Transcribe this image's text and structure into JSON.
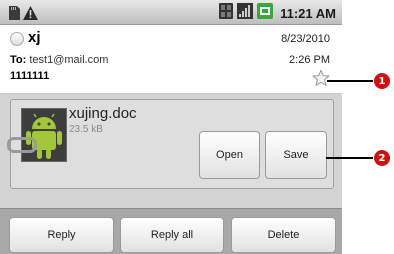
{
  "status_bar": {
    "time": "11:21 AM",
    "left_icons": [
      "sd-card-icon",
      "warning-icon"
    ],
    "right_icons": [
      "3g-icon",
      "signal-icon",
      "battery-icon"
    ]
  },
  "message": {
    "sender": "xj",
    "date": "8/23/2010",
    "time": "2:26 PM",
    "to_label": "To:",
    "to_value": "test1@mail.com",
    "subject": "1111111",
    "starred": false
  },
  "attachment": {
    "filename": "xujing.doc",
    "size": "23.5 kB",
    "open_label": "Open",
    "save_label": "Save"
  },
  "bottom_bar": {
    "reply_label": "Reply",
    "reply_all_label": "Reply all",
    "delete_label": "Delete"
  },
  "callouts": [
    "1",
    "2"
  ],
  "colors": {
    "callout": "#cc1111",
    "android_green": "#a4c639",
    "battery_green": "#3aa53a"
  }
}
